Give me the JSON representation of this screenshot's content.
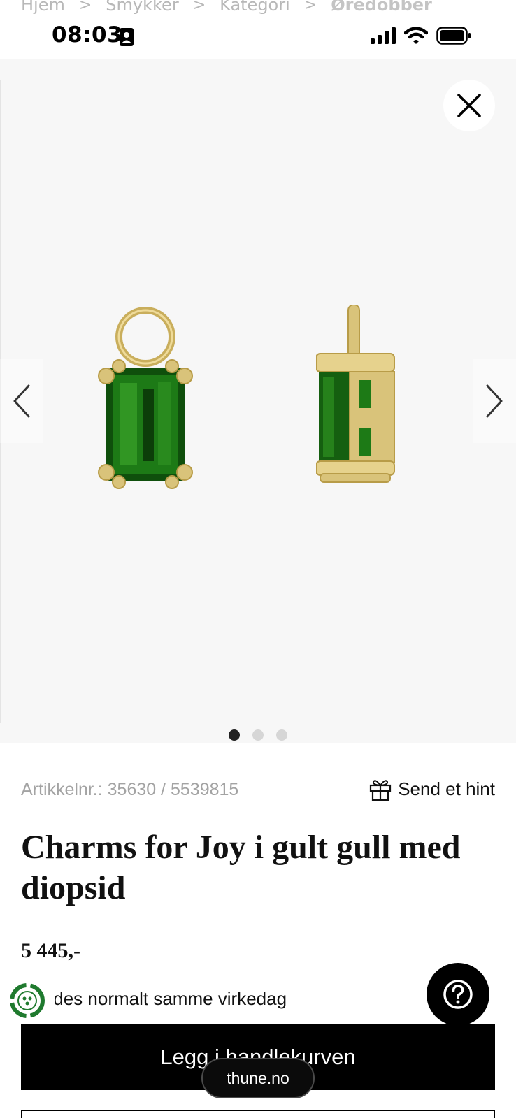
{
  "breadcrumb": {
    "items": [
      "Hjem",
      "Smykker",
      "Kategori",
      "Øredobber"
    ],
    "separator": ">"
  },
  "status_bar": {
    "time": "08:03",
    "icons": [
      "contact-card-icon",
      "cellular-signal-icon",
      "wifi-icon",
      "battery-icon"
    ]
  },
  "gallery": {
    "close_icon": "close-icon",
    "prev_icon": "chevron-left-icon",
    "next_icon": "chevron-right-icon",
    "image_count": 3,
    "active_index": 0,
    "images": [
      "charm-front-image",
      "charm-side-image"
    ]
  },
  "product": {
    "sku": "Artikkelnr.: 35630 / 5539815",
    "hint_label": "Send et hint",
    "hint_icon": "gift-icon",
    "title": "Charms for Joy i gult gull med diopsid",
    "price": "5 445,-",
    "delivery": "Sendes normalt samme virkedag",
    "add_to_cart": "Legg i handlekurven"
  },
  "overlays": {
    "help_icon": "question-icon",
    "eco_icon": "eco-badge-icon",
    "url": "thune.no"
  },
  "colors": {
    "gallery_bg": "#f7f7f7",
    "button_bg": "#000000",
    "gem_green": "#1f7a16",
    "gold": "#d9c37a"
  }
}
